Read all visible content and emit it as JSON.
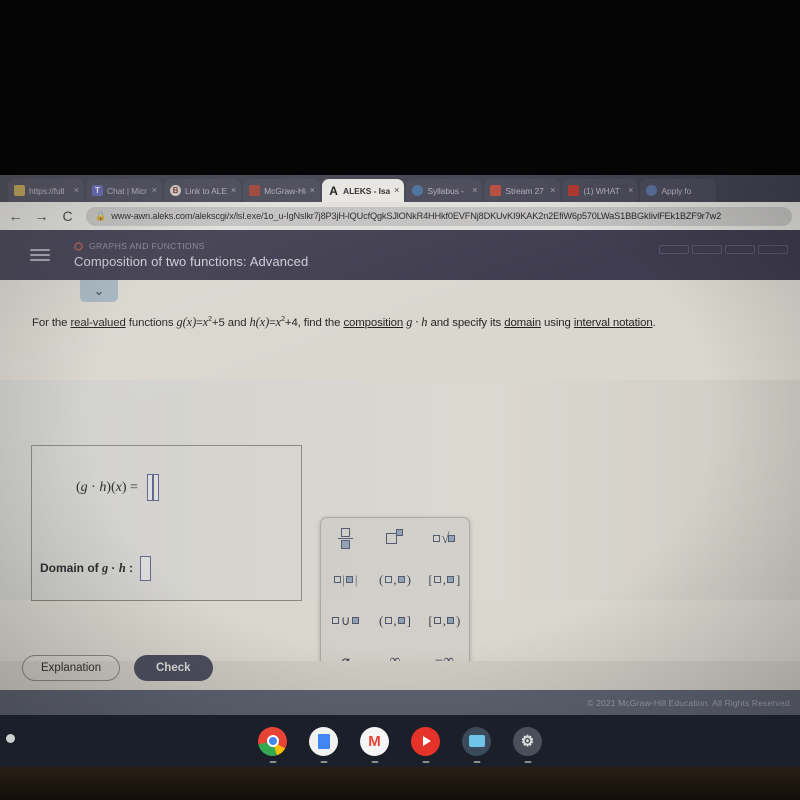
{
  "browser": {
    "tabs": [
      {
        "label": "https://full",
        "favicon": "generic-page-icon",
        "active": false
      },
      {
        "label": "Chat | Micr",
        "favicon": "teams-icon",
        "active": false
      },
      {
        "label": "Link to ALE",
        "favicon": "blackboard-icon",
        "active": false
      },
      {
        "label": "McGraw-Hi",
        "favicon": "mcgraw-hill-icon",
        "active": false
      },
      {
        "label": "ALEKS - Isa",
        "favicon": "aleks-icon",
        "active": true
      },
      {
        "label": "Syllabus -",
        "favicon": "cloud-icon",
        "active": false
      },
      {
        "label": "Stream 27",
        "favicon": "classroom-icon",
        "active": false
      },
      {
        "label": "(1) WHAT",
        "favicon": "youtube-icon",
        "active": false
      },
      {
        "label": "Apply fo",
        "favicon": "globe-icon",
        "active": false
      }
    ],
    "close_glyph": "×",
    "nav": {
      "back": "←",
      "forward": "→",
      "reload": "C",
      "lock": "🔒"
    },
    "url": "www-awn.aleks.com/alekscgi/x/lsl.exe/1o_u-IgNslkr7j8P3jH-lQUcfQgkSJlONkR4HHkf0EVFNj8DKUvKI9KAK2n2EfiW6p570LWaS1BBGkIivlFEk1BZF9r7w2"
  },
  "aleks_header": {
    "menu_icon": "hamburger-icon",
    "topic": "GRAPHS AND FUNCTIONS",
    "title": "Composition of two functions: Advanced",
    "progress_segment_count": 4
  },
  "worksheet": {
    "collapse_chevron": "⌄",
    "problem": {
      "part1": "For the ",
      "link1": "real-valued",
      "part2": " functions ",
      "g_name": "g",
      "g_arg": "(x)",
      "eq": "=",
      "g_body_base": "x",
      "exponent": "2",
      "g_body_tail": "+5 and ",
      "h_name": "h",
      "h_arg": "(x)",
      "h_body_tail": "+4, find the ",
      "link2": "composition",
      "comp_expr": "g · h",
      "part3": " and specify its ",
      "link3": "domain",
      "part4": " using ",
      "link4": "interval notation",
      "period": "."
    },
    "answers": {
      "composition_label_open": "(",
      "composition_label_g": "g",
      "composition_label_dot": " · ",
      "composition_label_h": "h",
      "composition_label_close": ")(",
      "composition_label_x": "x",
      "composition_label_end": ") = ",
      "domain_label_prefix": "Domain of ",
      "domain_label_g": "g",
      "domain_label_dot": " · ",
      "domain_label_h": "h",
      "domain_label_colon": " : ",
      "composition_value": "",
      "domain_value": ""
    }
  },
  "palette": {
    "keys": [
      {
        "name": "fraction-key",
        "glyph": "fraction"
      },
      {
        "name": "exponent-key",
        "glyph": "power"
      },
      {
        "name": "nth-root-key",
        "glyph": "root"
      },
      {
        "name": "absolute-value-key",
        "glyph": "abs"
      },
      {
        "name": "open-interval-key",
        "glyph": "(□,□)"
      },
      {
        "name": "closed-interval-key",
        "glyph": "[□,□]"
      },
      {
        "name": "union-key",
        "glyph": "union"
      },
      {
        "name": "half-open-right-key",
        "glyph": "(□,□]"
      },
      {
        "name": "half-open-left-key",
        "glyph": "[□,□)"
      },
      {
        "name": "empty-set-key",
        "glyph": "⌀"
      },
      {
        "name": "infinity-key",
        "glyph": "∞"
      },
      {
        "name": "negative-infinity-key",
        "glyph": "−∞"
      }
    ],
    "footer": [
      {
        "name": "clear-key",
        "glyph": "×"
      },
      {
        "name": "undo-key",
        "glyph": "↺"
      },
      {
        "name": "help-key",
        "glyph": "?"
      }
    ],
    "interval_glyphs": {
      "paren_open": "(",
      "paren_close": ")",
      "bracket_open": "[",
      "bracket_close": "]",
      "comma": ",",
      "bar": "|",
      "union": "∪"
    }
  },
  "actions": {
    "explanation_label": "Explanation",
    "check_label": "Check"
  },
  "footer": {
    "copyright": "© 2021 McGraw-Hill Education. All Rights Reserved."
  },
  "shelf": {
    "apps": [
      {
        "name": "chrome",
        "label": ""
      },
      {
        "name": "docs",
        "label": ""
      },
      {
        "name": "gmail",
        "label": "M"
      },
      {
        "name": "youtube",
        "label": ""
      },
      {
        "name": "files",
        "label": ""
      },
      {
        "name": "settings",
        "label": "⚙"
      }
    ]
  },
  "colors": {
    "header_bg": "#3a3850",
    "page_bg": "#e3dfd5",
    "accent_blue": "#5b5f9b",
    "palette_footer": "#b9c6d6",
    "check_button": "#4a4d63"
  }
}
